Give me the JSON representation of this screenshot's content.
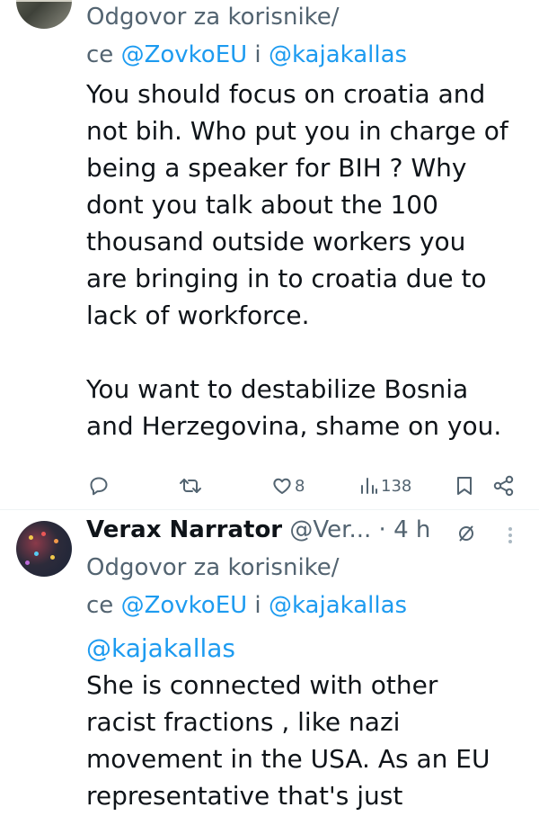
{
  "tweet1": {
    "reply_to_label": "Odgovor za korisnike/",
    "reply_to_suffix": "ce ",
    "mention_1": "@ZovkoEU",
    "mention_sep": " i ",
    "mention_2": "@kajakallas",
    "body_lines": [
      "You should focus on croatia and",
      "not bih. Who put you in charge of",
      "being a speaker for BIH ? Why",
      "dont you talk about the 100",
      "thousand outside workers you",
      "are bringing in to croatia due to",
      "lack of workforce.",
      "",
      "You want to destabilize Bosnia",
      "and Herzegovina, shame on you."
    ],
    "actions": {
      "likes": "8",
      "views": "138"
    }
  },
  "tweet2": {
    "display_name": "Verax Narrator",
    "handle": "@Ver...",
    "separator": "·",
    "time": "4 h",
    "reply_to_label": "Odgovor za korisnike/",
    "reply_to_suffix": "ce ",
    "mention_1": "@ZovkoEU",
    "mention_sep": " i ",
    "mention_2": "@kajakallas",
    "extra_mention": "@kajakallas",
    "body_lines": [
      "She is connected with other",
      "racist fractions , like nazi",
      "movement in the USA. As an EU",
      "representative that's just"
    ]
  },
  "icons": {
    "reply": "reply-icon",
    "retweet": "retweet-icon",
    "like": "heart-icon",
    "views": "views-icon",
    "bookmark": "bookmark-icon",
    "share": "share-icon",
    "grok": "grok-icon",
    "more": "more-icon"
  },
  "colors": {
    "link": "#1d9bf0",
    "secondary_text": "#536471",
    "primary_text": "#0f1419"
  }
}
